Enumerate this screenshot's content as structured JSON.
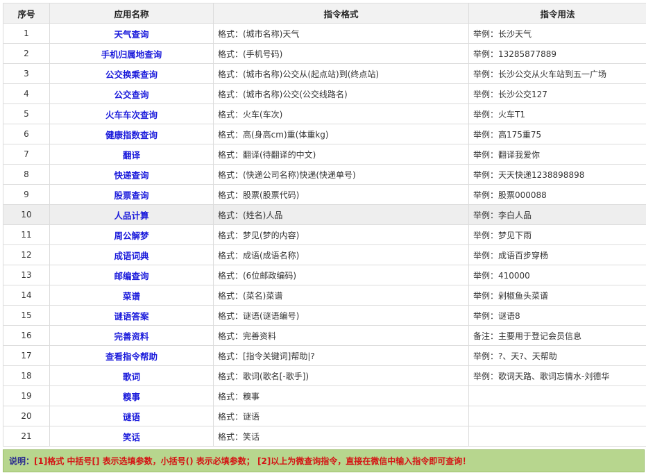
{
  "headers": {
    "no": "序号",
    "name": "应用名称",
    "format": "指令格式",
    "usage": "指令用法"
  },
  "rows": [
    {
      "no": "1",
      "name": "天气查询",
      "format": "格式：(城市名称)天气",
      "usage": "举例：长沙天气"
    },
    {
      "no": "2",
      "name": "手机归属地查询",
      "format": "格式：(手机号码)",
      "usage": "举例：13285877889"
    },
    {
      "no": "3",
      "name": "公交换乘查询",
      "format": "格式：(城市名称)公交从(起点站)到(终点站)",
      "usage": "举例：长沙公交从火车站到五一广场"
    },
    {
      "no": "4",
      "name": "公交查询",
      "format": "格式：(城市名称)公交(公交线路名)",
      "usage": "举例：长沙公交127"
    },
    {
      "no": "5",
      "name": "火车车次查询",
      "format": "格式：火车(车次)",
      "usage": "举例：火车T1"
    },
    {
      "no": "6",
      "name": "健康指数查询",
      "format": "格式：高(身高cm)重(体重kg)",
      "usage": "举例：高175重75"
    },
    {
      "no": "7",
      "name": "翻译",
      "format": "格式：翻译(待翻译的中文)",
      "usage": "举例：翻译我爱你"
    },
    {
      "no": "8",
      "name": "快递查询",
      "format": "格式：(快递公司名称)快递(快递单号)",
      "usage": "举例：天天快递1238898898"
    },
    {
      "no": "9",
      "name": "股票查询",
      "format": "格式：股票(股票代码)",
      "usage": "举例：股票000088"
    },
    {
      "no": "10",
      "name": "人品计算",
      "format": "格式：(姓名)人品",
      "usage": "举例：李白人品"
    },
    {
      "no": "11",
      "name": "周公解梦",
      "format": "格式：梦见(梦的内容)",
      "usage": "举例：梦见下雨"
    },
    {
      "no": "12",
      "name": "成语词典",
      "format": "格式：成语(成语名称)",
      "usage": "举例：成语百步穿杨"
    },
    {
      "no": "13",
      "name": "邮编查询",
      "format": "格式：(6位邮政编码)",
      "usage": "举例：410000"
    },
    {
      "no": "14",
      "name": "菜谱",
      "format": "格式：(菜名)菜谱",
      "usage": "举例：剁椒鱼头菜谱"
    },
    {
      "no": "15",
      "name": "谜语答案",
      "format": "格式：谜语(谜语编号)",
      "usage": "举例：谜语8"
    },
    {
      "no": "16",
      "name": "完善资料",
      "format": "格式：完善资料",
      "usage": "备注：主要用于登记会员信息"
    },
    {
      "no": "17",
      "name": "查看指令帮助",
      "format": "格式：[指令关键词]帮助|?",
      "usage": "举例：?、天?、天帮助"
    },
    {
      "no": "18",
      "name": "歌词",
      "format": "格式：歌词(歌名[-歌手])",
      "usage": "举例：歌词天路、歌词忘情水-刘德华"
    },
    {
      "no": "19",
      "name": "糗事",
      "format": "格式：糗事",
      "usage": ""
    },
    {
      "no": "20",
      "name": "谜语",
      "format": "格式：谜语",
      "usage": ""
    },
    {
      "no": "21",
      "name": "笑话",
      "format": "格式：笑话",
      "usage": ""
    }
  ],
  "footer": {
    "label": "说明：",
    "text": "[1]格式 中括号[] 表示选填参数，小括号() 表示必填参数；  [2]以上为微查询指令，直接在微信中输入指令即可查询！"
  },
  "colors": {
    "name_link": "#1a1adb",
    "footer_bg": "#b7d68e",
    "footer_text": "#d41414",
    "footer_label": "#2b2b8f"
  }
}
